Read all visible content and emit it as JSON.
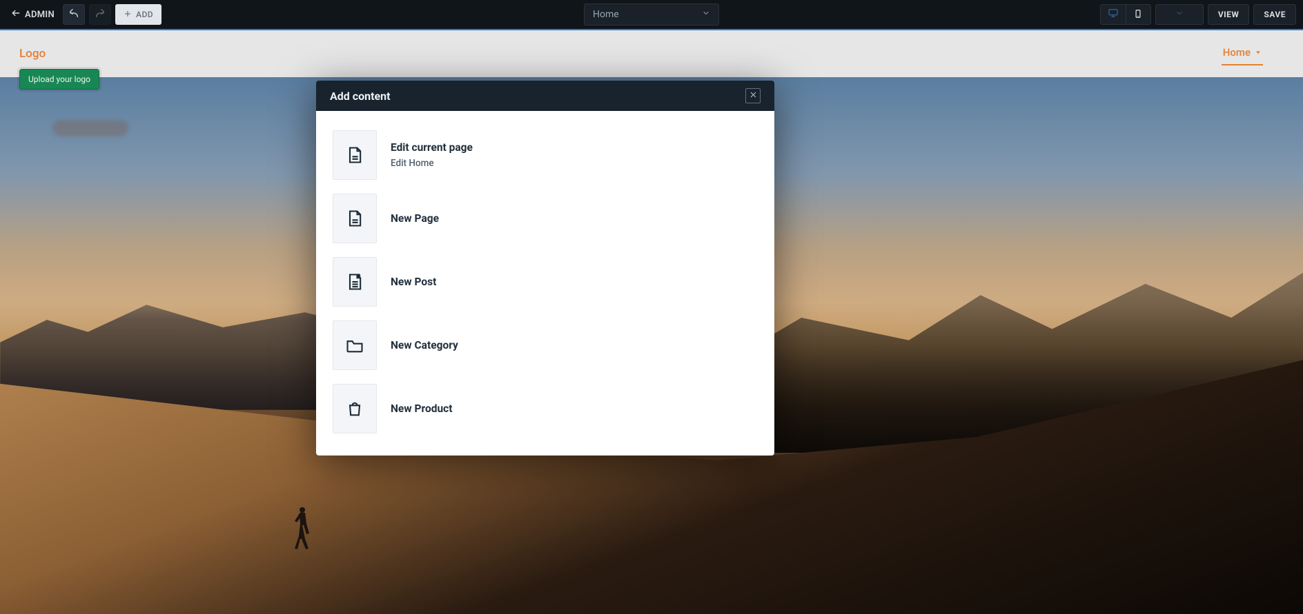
{
  "toolbar": {
    "admin_label": "ADMIN",
    "add_label": "ADD",
    "page_select_value": "Home",
    "view_label": "VIEW",
    "save_label": "SAVE"
  },
  "site_header": {
    "logo_text": "Logo",
    "upload_logo_label": "Upload your logo",
    "nav_home_label": "Home"
  },
  "modal": {
    "title": "Add content",
    "options": [
      {
        "title": "Edit current page",
        "sub": "Edit Home"
      },
      {
        "title": "New Page"
      },
      {
        "title": "New Post"
      },
      {
        "title": "New Category"
      },
      {
        "title": "New Product"
      }
    ]
  }
}
